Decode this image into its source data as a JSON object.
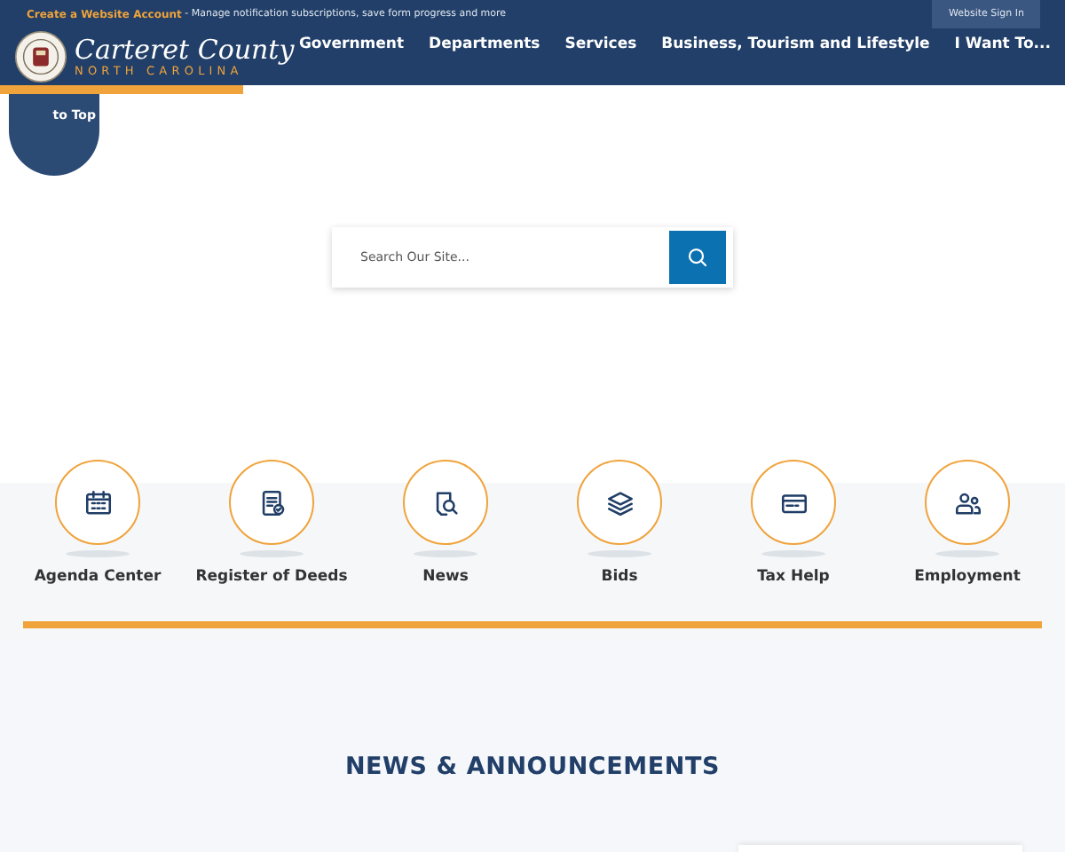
{
  "top_bar": {
    "link": "Create a Website Account",
    "text": " - Manage notification subscriptions, save form progress and more",
    "sign_in": "Website Sign In"
  },
  "logo": {
    "title": "Carteret County",
    "subtitle": "NORTH CAROLINA"
  },
  "nav": [
    "Government",
    "Departments",
    "Services",
    "Business, Tourism and Lifestyle",
    "I Want To..."
  ],
  "back_to_top": "to Top",
  "search": {
    "placeholder": "Search Our Site..."
  },
  "quick_links": [
    {
      "label": "Agenda Center",
      "kind": "calendar"
    },
    {
      "label": "Register of Deeds",
      "kind": "document"
    },
    {
      "label": "News",
      "kind": "news"
    },
    {
      "label": "Bids",
      "kind": "layers"
    },
    {
      "label": "Tax Help",
      "kind": "card"
    },
    {
      "label": "Employment",
      "kind": "people"
    }
  ],
  "section_heading": "NEWS & ANNOUNCEMENTS"
}
